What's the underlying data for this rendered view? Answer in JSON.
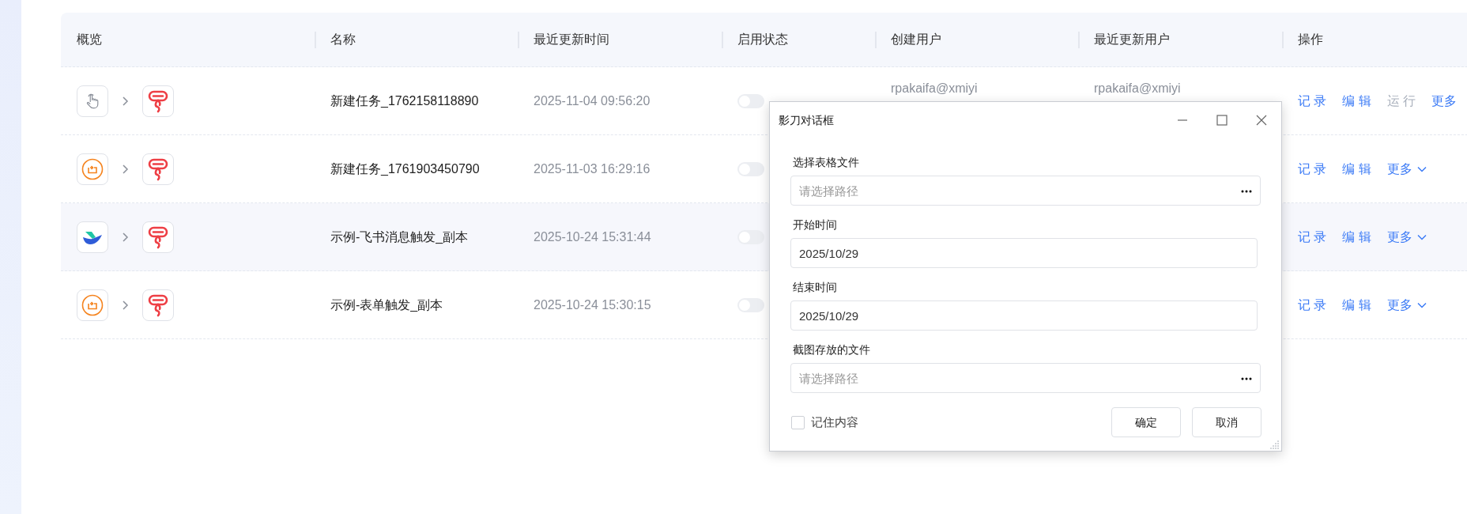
{
  "table": {
    "columns": [
      "概览",
      "名称",
      "最近更新时间",
      "启用状态",
      "创建用户",
      "最近更新用户",
      "操作"
    ],
    "rows": [
      {
        "kind": "manual",
        "hovered": false,
        "name": "新建任务_1762158118890",
        "updated": "2025-11-04 09:56:20",
        "enabled": false,
        "creator": "rpakaifa@xmiyi",
        "updater": "rpakaifa@xmiyi",
        "actions": [
          {
            "label": "记 录",
            "disabled": false,
            "dropdown": false
          },
          {
            "label": "编 辑",
            "disabled": false,
            "dropdown": false
          },
          {
            "label": "运 行",
            "disabled": true,
            "dropdown": false
          },
          {
            "label": "更多",
            "disabled": false,
            "dropdown": false
          }
        ]
      },
      {
        "kind": "timer",
        "hovered": false,
        "name": "新建任务_1761903450790",
        "updated": "2025-11-03 16:29:16",
        "enabled": false,
        "actions": [
          {
            "label": "记 录",
            "disabled": false,
            "dropdown": false
          },
          {
            "label": "编 辑",
            "disabled": false,
            "dropdown": false
          },
          {
            "label": "更多",
            "disabled": false,
            "dropdown": true
          }
        ]
      },
      {
        "kind": "bird",
        "hovered": true,
        "name": "示例-飞书消息触发_副本",
        "updated": "2025-10-24 15:31:44",
        "enabled": false,
        "actions": [
          {
            "label": "记 录",
            "disabled": false,
            "dropdown": false
          },
          {
            "label": "编 辑",
            "disabled": false,
            "dropdown": false
          },
          {
            "label": "更多",
            "disabled": false,
            "dropdown": true
          }
        ]
      },
      {
        "kind": "timer",
        "hovered": false,
        "name": "示例-表单触发_副本",
        "updated": "2025-10-24 15:30:15",
        "enabled": false,
        "actions": [
          {
            "label": "记 录",
            "disabled": false,
            "dropdown": false
          },
          {
            "label": "编 辑",
            "disabled": false,
            "dropdown": false
          },
          {
            "label": "更多",
            "disabled": false,
            "dropdown": true
          }
        ]
      }
    ]
  },
  "dialog": {
    "title": "影刀对话框",
    "fields": [
      {
        "label": "选择表格文件",
        "kind": "path",
        "placeholder": "请选择路径"
      },
      {
        "label": "开始时间",
        "kind": "date",
        "value": "2025/10/29"
      },
      {
        "label": "结束时间",
        "kind": "date",
        "value": "2025/10/29"
      },
      {
        "label": "截图存放的文件",
        "kind": "path",
        "placeholder": "请选择路径"
      }
    ],
    "remember": {
      "label": "记住内容",
      "checked": false
    },
    "buttons": [
      "确定",
      "取消"
    ]
  }
}
